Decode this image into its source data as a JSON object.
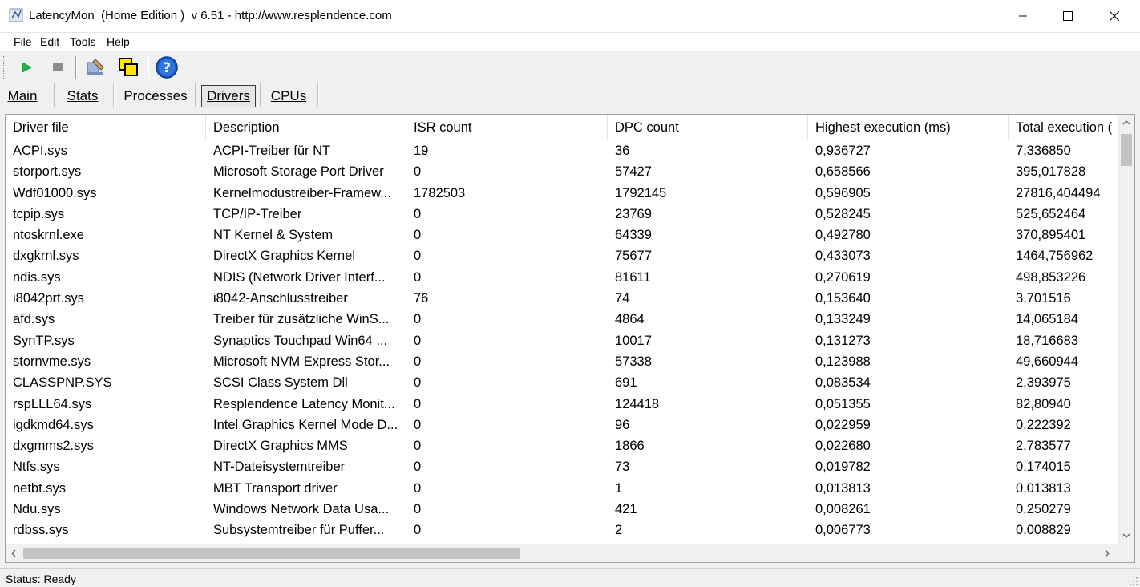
{
  "window": {
    "title": "LatencyMon  (Home Edition )  v 6.51 - http://www.resplendence.com",
    "minimize_glyph": "—",
    "maximize_glyph": "☐",
    "close_glyph": "✕"
  },
  "menu": [
    {
      "label_ul": "F",
      "label_rest": "ile"
    },
    {
      "label_ul": "E",
      "label_rest": "dit"
    },
    {
      "label_ul": "T",
      "label_rest": "ools"
    },
    {
      "label_ul": "H",
      "label_rest": "elp"
    }
  ],
  "toolbar": {
    "buttons": [
      "play-icon",
      "stop-icon",
      "tool-icon",
      "windows-icon",
      "help-icon"
    ]
  },
  "tabs": [
    {
      "label": "Main",
      "active": false
    },
    {
      "label": "Stats",
      "active": false
    },
    {
      "label": "Processes",
      "active": false
    },
    {
      "label": "Drivers",
      "active": true
    },
    {
      "label": "CPUs",
      "active": false
    }
  ],
  "table": {
    "columns": [
      "Driver file",
      "Description",
      "ISR count",
      "DPC count",
      "Highest execution (ms)",
      "Total execution ("
    ],
    "rows": [
      [
        "ACPI.sys",
        "ACPI-Treiber für NT",
        "19",
        "36",
        "0,936727",
        "7,336850"
      ],
      [
        "storport.sys",
        "Microsoft Storage Port Driver",
        "0",
        "57427",
        "0,658566",
        "395,017828"
      ],
      [
        "Wdf01000.sys",
        "Kernelmodustreiber-Framew...",
        "1782503",
        "1792145",
        "0,596905",
        "27816,404494"
      ],
      [
        "tcpip.sys",
        "TCP/IP-Treiber",
        "0",
        "23769",
        "0,528245",
        "525,652464"
      ],
      [
        "ntoskrnl.exe",
        "NT Kernel & System",
        "0",
        "64339",
        "0,492780",
        "370,895401"
      ],
      [
        "dxgkrnl.sys",
        "DirectX Graphics Kernel",
        "0",
        "75677",
        "0,433073",
        "1464,756962"
      ],
      [
        "ndis.sys",
        "NDIS (Network Driver Interf...",
        "0",
        "81611",
        "0,270619",
        "498,853226"
      ],
      [
        "i8042prt.sys",
        "i8042-Anschlusstreiber",
        "76",
        "74",
        "0,153640",
        "3,701516"
      ],
      [
        "afd.sys",
        "Treiber für zusätzliche WinS...",
        "0",
        "4864",
        "0,133249",
        "14,065184"
      ],
      [
        "SynTP.sys",
        "Synaptics Touchpad Win64 ...",
        "0",
        "10017",
        "0,131273",
        "18,716683"
      ],
      [
        "stornvme.sys",
        "Microsoft NVM Express Stor...",
        "0",
        "57338",
        "0,123988",
        "49,660944"
      ],
      [
        "CLASSPNP.SYS",
        "SCSI Class System Dll",
        "0",
        "691",
        "0,083534",
        "2,393975"
      ],
      [
        "rspLLL64.sys",
        "Resplendence Latency Monit...",
        "0",
        "124418",
        "0,051355",
        "82,80940"
      ],
      [
        "igdkmd64.sys",
        "Intel Graphics Kernel Mode D...",
        "0",
        "96",
        "0,022959",
        "0,222392"
      ],
      [
        "dxgmms2.sys",
        "DirectX Graphics MMS",
        "0",
        "1866",
        "0,022680",
        "2,783577"
      ],
      [
        "Ntfs.sys",
        "NT-Dateisystemtreiber",
        "0",
        "73",
        "0,019782",
        "0,174015"
      ],
      [
        "netbt.sys",
        "MBT Transport driver",
        "0",
        "1",
        "0,013813",
        "0,013813"
      ],
      [
        "Ndu.sys",
        "Windows Network Data Usa...",
        "0",
        "421",
        "0,008261",
        "0,250279"
      ],
      [
        "rdbss.sys",
        "Subsystemtreiber für Puffer...",
        "0",
        "2",
        "0,006773",
        "0,008829"
      ]
    ]
  },
  "status": {
    "text": "Status: Ready"
  },
  "colors": {
    "play": "#22b14c",
    "stop": "#808080",
    "help": "#1e5fc8"
  }
}
